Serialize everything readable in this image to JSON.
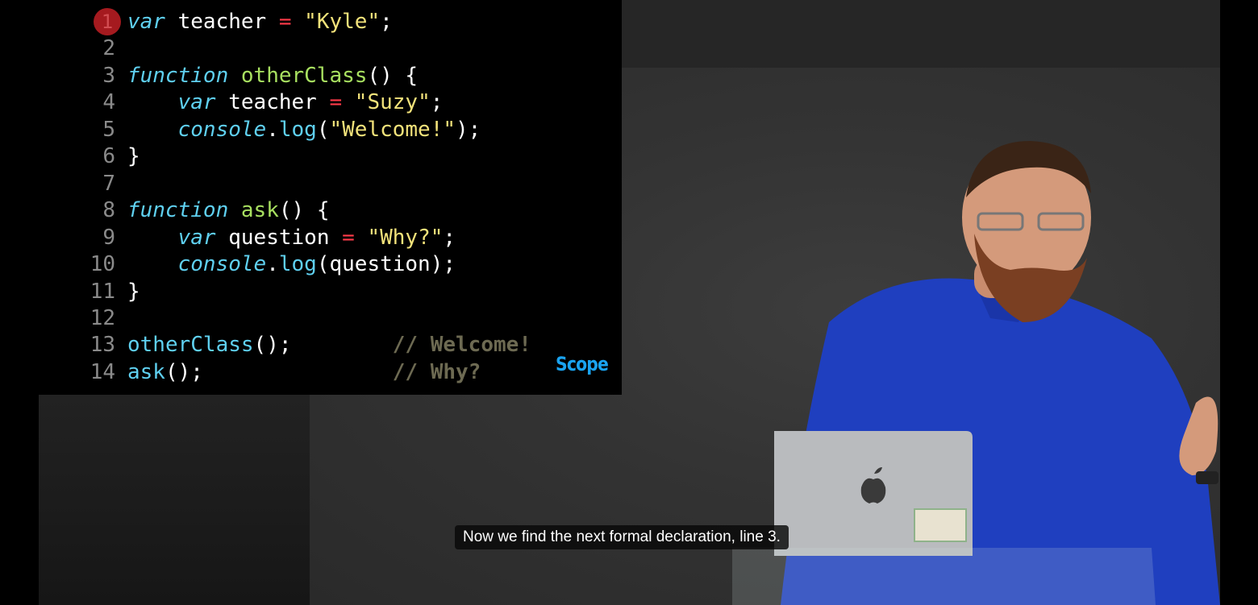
{
  "code": {
    "lines": [
      {
        "num": "1",
        "tokens": [
          {
            "t": "var",
            "c": "kw"
          },
          {
            "t": " teacher ",
            "c": "plain"
          },
          {
            "t": "=",
            "c": "op"
          },
          {
            "t": " ",
            "c": "plain"
          },
          {
            "t": "\"Kyle\"",
            "c": "str"
          },
          {
            "t": ";",
            "c": "plain"
          }
        ]
      },
      {
        "num": "2",
        "tokens": []
      },
      {
        "num": "3",
        "tokens": [
          {
            "t": "function",
            "c": "kw"
          },
          {
            "t": " ",
            "c": "plain"
          },
          {
            "t": "otherClass",
            "c": "fn"
          },
          {
            "t": "() {",
            "c": "plain"
          }
        ]
      },
      {
        "num": "4",
        "tokens": [
          {
            "t": "    ",
            "c": "plain"
          },
          {
            "t": "var",
            "c": "kw"
          },
          {
            "t": " teacher ",
            "c": "plain"
          },
          {
            "t": "=",
            "c": "op"
          },
          {
            "t": " ",
            "c": "plain"
          },
          {
            "t": "\"Suzy\"",
            "c": "str"
          },
          {
            "t": ";",
            "c": "plain"
          }
        ]
      },
      {
        "num": "5",
        "tokens": [
          {
            "t": "    ",
            "c": "plain"
          },
          {
            "t": "console",
            "c": "obj"
          },
          {
            "t": ".",
            "c": "plain"
          },
          {
            "t": "log",
            "c": "call"
          },
          {
            "t": "(",
            "c": "plain"
          },
          {
            "t": "\"Welcome!\"",
            "c": "str"
          },
          {
            "t": ");",
            "c": "plain"
          }
        ]
      },
      {
        "num": "6",
        "tokens": [
          {
            "t": "}",
            "c": "plain"
          }
        ]
      },
      {
        "num": "7",
        "tokens": []
      },
      {
        "num": "8",
        "tokens": [
          {
            "t": "function",
            "c": "kw"
          },
          {
            "t": " ",
            "c": "plain"
          },
          {
            "t": "ask",
            "c": "fn"
          },
          {
            "t": "() {",
            "c": "plain"
          }
        ]
      },
      {
        "num": "9",
        "tokens": [
          {
            "t": "    ",
            "c": "plain"
          },
          {
            "t": "var",
            "c": "kw"
          },
          {
            "t": " question ",
            "c": "plain"
          },
          {
            "t": "=",
            "c": "op"
          },
          {
            "t": " ",
            "c": "plain"
          },
          {
            "t": "\"Why?\"",
            "c": "str"
          },
          {
            "t": ";",
            "c": "plain"
          }
        ]
      },
      {
        "num": "10",
        "tokens": [
          {
            "t": "    ",
            "c": "plain"
          },
          {
            "t": "console",
            "c": "obj"
          },
          {
            "t": ".",
            "c": "plain"
          },
          {
            "t": "log",
            "c": "call"
          },
          {
            "t": "(question);",
            "c": "plain"
          }
        ]
      },
      {
        "num": "11",
        "tokens": [
          {
            "t": "}",
            "c": "plain"
          }
        ]
      },
      {
        "num": "12",
        "tokens": []
      },
      {
        "num": "13",
        "tokens": [
          {
            "t": "otherClass",
            "c": "call"
          },
          {
            "t": "();",
            "c": "plain"
          },
          {
            "t": "        ",
            "c": "plain"
          },
          {
            "t": "// Welcome!",
            "c": "comment"
          }
        ]
      },
      {
        "num": "14",
        "tokens": [
          {
            "t": "ask",
            "c": "call"
          },
          {
            "t": "();",
            "c": "plain"
          },
          {
            "t": "               ",
            "c": "plain"
          },
          {
            "t": "// Why?",
            "c": "comment"
          }
        ]
      }
    ],
    "breakpoint_line": "1"
  },
  "slide": {
    "section_label": "Scope"
  },
  "caption": {
    "text": "Now we find the next formal declaration, line 3."
  },
  "colors": {
    "keyword": "#5fd0f0",
    "function_name": "#a8e060",
    "operator": "#ff3b4a",
    "string": "#f2e27a",
    "comment": "#6d6a52",
    "scope_label": "#1aa3f0",
    "breakpoint": "#a51a1f"
  }
}
